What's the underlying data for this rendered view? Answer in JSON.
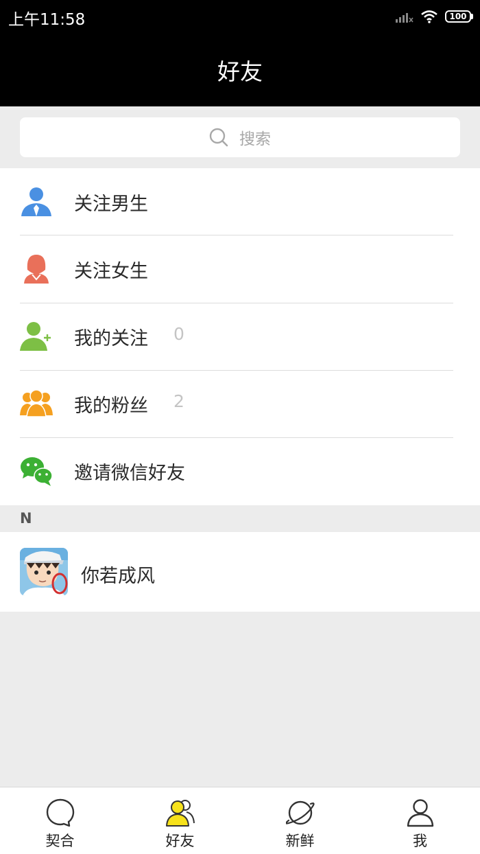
{
  "status_bar": {
    "time": "上午11:58",
    "battery": "100"
  },
  "header": {
    "title": "好友"
  },
  "search": {
    "placeholder": "搜索"
  },
  "menu": [
    {
      "label": "关注男生",
      "icon": "male-user-icon",
      "color": "#4a90e2"
    },
    {
      "label": "关注女生",
      "icon": "female-user-icon",
      "color": "#e9705a"
    },
    {
      "label": "我的关注",
      "count": "0",
      "icon": "add-user-icon",
      "color": "#7dbf45"
    },
    {
      "label": "我的粉丝",
      "count": "2",
      "icon": "group-icon",
      "color": "#f5a020"
    },
    {
      "label": "邀请微信好友",
      "icon": "wechat-icon",
      "color": "#3cb034"
    }
  ],
  "section": {
    "letter": "N"
  },
  "friends": [
    {
      "name": "你若成风",
      "avatar": "avatar-image"
    }
  ],
  "tabs": [
    {
      "label": "契合",
      "icon": "chat-bubble-icon",
      "active": false
    },
    {
      "label": "好友",
      "icon": "friends-icon",
      "active": true
    },
    {
      "label": "新鲜",
      "icon": "planet-icon",
      "active": false
    },
    {
      "label": "我",
      "icon": "person-icon",
      "active": false
    }
  ],
  "colors": {
    "active_tab": "#f7e21b",
    "header_bg": "#000000",
    "page_bg": "#ececec"
  }
}
